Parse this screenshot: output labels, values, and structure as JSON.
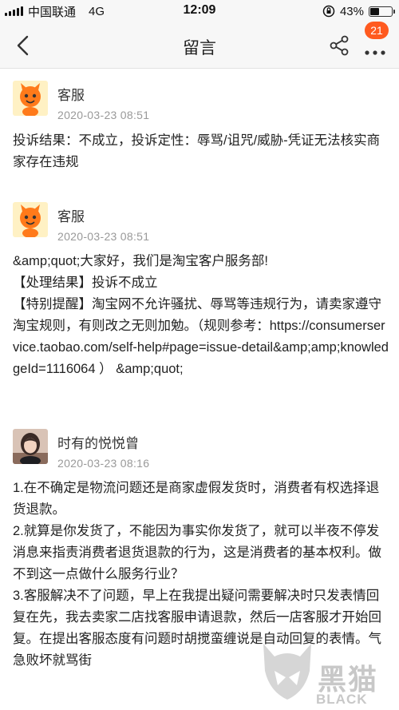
{
  "status_bar": {
    "carrier": "中国联通",
    "network": "4G",
    "time": "12:09",
    "battery": "43%",
    "battery_level": 0.43
  },
  "nav": {
    "title": "留言",
    "badge": "21"
  },
  "messages": [
    {
      "name": "客服",
      "time": "2020-03-23 08:51",
      "lines": [
        "投诉结果：不成立，投诉定性：辱骂/诅咒/威胁-凭证无法核实商家存在违规"
      ]
    },
    {
      "name": "客服",
      "time": "2020-03-23 08:51",
      "lines": [
        "&amp;quot;大家好，我们是淘宝客户服务部!",
        "【处理结果】投诉不成立",
        "【特别提醒】淘宝网不允许骚扰、辱骂等违规行为，请卖家遵守淘宝规则，有则改之无则加勉。（规则参考：https://consumerservice.taobao.com/self-help#page=issue-detail&amp;amp;knowledgeId=1116064 ） &amp;quot;"
      ]
    },
    {
      "name": "时有的悦悦曾",
      "time": "2020-03-23 08:16",
      "lines": [
        "1.在不确定是物流问题还是商家虚假发货时，消费者有权选择退货退款。",
        "2.就算是你发货了，不能因为事实你发货了，就可以半夜不停发消息来指责消费者退货退款的行为，这是消费者的基本权利。做不到这一点做什么服务行业？",
        "3.客服解决不了问题，早上在我提出疑问需要解决时只发表情回复在先，我去卖家二店找客服申请退款，然后一店客服才开始回复。在提出客服态度有问题时胡搅蛮缠说是自动回复的表情。气急败坏就骂街"
      ]
    }
  ],
  "watermark": {
    "text_cn": "黑猫",
    "text_en": "BLACK CAT"
  }
}
